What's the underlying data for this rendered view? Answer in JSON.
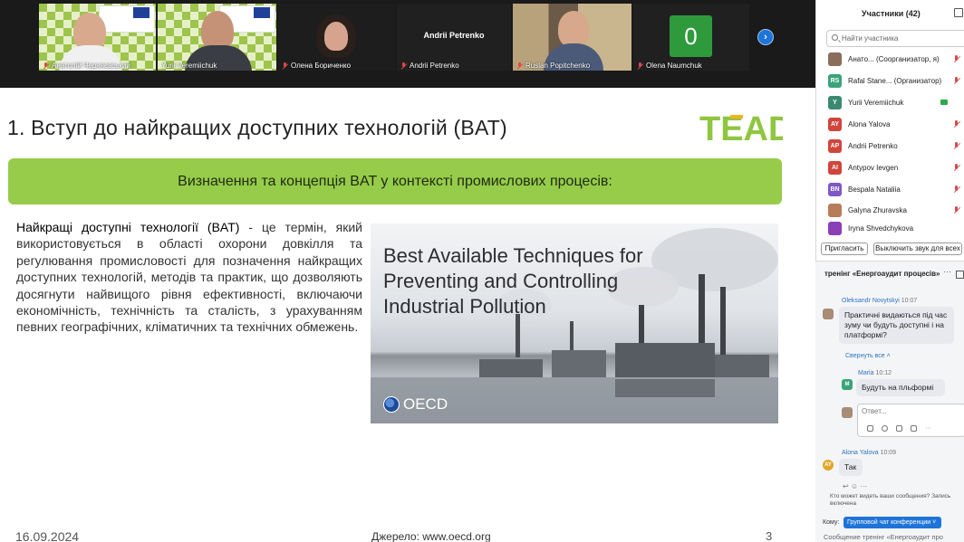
{
  "video_strip": {
    "tiles": [
      {
        "name": "Анатолій Черняєвський"
      },
      {
        "name": "Yurii Veremiichuk"
      },
      {
        "name": "Олена Бориченко"
      },
      {
        "name": "Andrii Petrenko",
        "center_label": "Andrii Petrenko"
      },
      {
        "name": "Ruslan Popitchenko"
      },
      {
        "name": "Olena Naumchuk",
        "center_label": "0"
      }
    ]
  },
  "slide": {
    "title": "1. Вступ до найкращих доступних технологій (BAT)",
    "logo_text": "TEAD",
    "banner": "Визначення та концепція BAT у контексті промислових процесів:",
    "body_lead": "Найкращі доступні технології (BAT)",
    "body_rest": " - це термін, який використовується в області охорони довкілля та регулювання промисловості для позначення найкращих доступних технологій, методів та практик, що дозволяють досягнути найвищого рівня ефективності, включаючи економічність, технічність та сталість, з урахуванням певних географічних, кліматичних та технічних обмежень.",
    "image_text": "Best Available Techniques for Preventing and Controlling Industrial Pollution",
    "image_brand": "OECD",
    "date": "16.09.2024",
    "source": "Джерело: www.oecd.org",
    "page_number": "3"
  },
  "participants": {
    "title": "Участники (42)",
    "search_placeholder": "Найти участника",
    "rows": [
      {
        "initials": "",
        "name": "Анато... (Соорганизатор, я)",
        "color": "#8a6d5a"
      },
      {
        "initials": "RS",
        "name": "Rafal Stane... (Организатор)",
        "color": "#3aa37a"
      },
      {
        "initials": "Y",
        "name": "Yurii Veremiichuk",
        "color": "#3a8a72"
      },
      {
        "initials": "AY",
        "name": "Alona Yalova",
        "color": "#d1453b"
      },
      {
        "initials": "AP",
        "name": "Andrii Petrenko",
        "color": "#d1453b"
      },
      {
        "initials": "AI",
        "name": "Antypov Ievgen",
        "color": "#d1453b"
      },
      {
        "initials": "BN",
        "name": "Bespala Nataliia",
        "color": "#7f57c6"
      },
      {
        "initials": "",
        "name": "Galyna Zhuravska",
        "color": "#b77c5a"
      },
      {
        "initials": "",
        "name": "Iryna Shvedchykova",
        "color": "#8a3fb7"
      }
    ],
    "invite_label": "Пригласить",
    "mute_all_label": "Выключить звук для всех"
  },
  "chat": {
    "title": "тренінг «Енергоаудит процесів»",
    "messages": [
      {
        "author": "Oleksandr Novytskyi",
        "time": "10:07",
        "text": "Практичні видаються під час зуму чи будуть доступні і на платформі?"
      },
      {
        "author": "Maria",
        "time": "10:12",
        "text": "Будуть на пльформі"
      },
      {
        "author": "Alona Yalova",
        "time": "10:09",
        "text": "Так"
      }
    ],
    "collapse_label": "Свернуть все",
    "reply_placeholder": "Ответ...",
    "who_sees": "Кто может видеть ваши сообщения? Запись включена",
    "to_label": "Кому:",
    "to_value": "Групповой чат конференции",
    "input_placeholder": "Сообщение тренінг «Енергоаудит про"
  },
  "colors": {
    "banner_green": "#96cc4a",
    "active_speaker": "#2fbf4f",
    "zoom_blue": "#1e74d9"
  }
}
